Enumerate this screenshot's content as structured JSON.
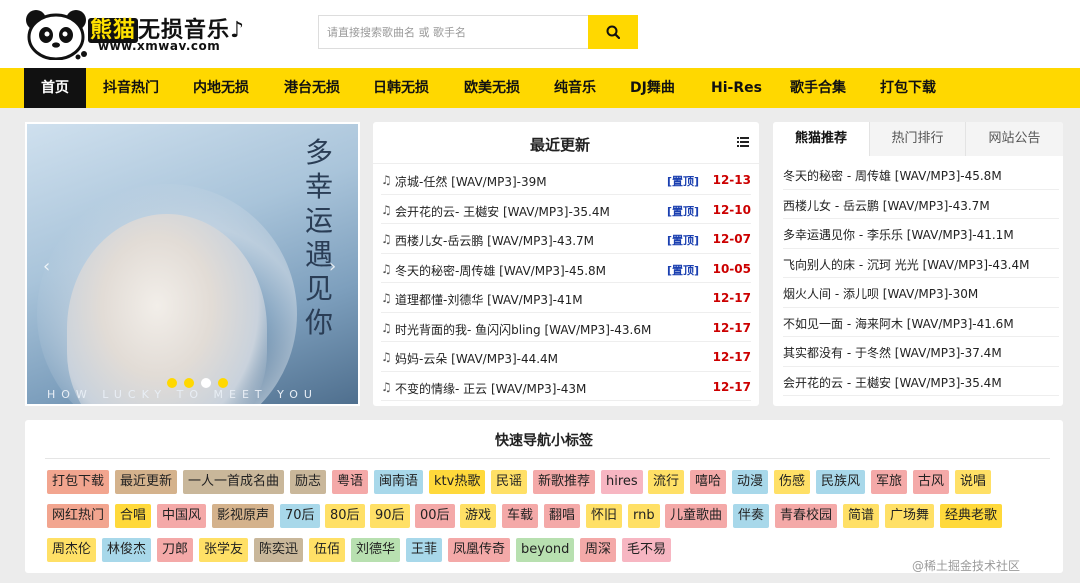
{
  "header": {
    "logo_title_highlight": "熊猫",
    "logo_title_rest": "无损音乐",
    "logo_url": "www.xmwav.com",
    "search_placeholder": "请直接搜索歌曲名 或 歌手名"
  },
  "nav": [
    "首页",
    "抖音热门",
    "内地无损",
    "港台无损",
    "日韩无损",
    "欧美无损",
    "纯音乐",
    "DJ舞曲",
    "Hi-Res",
    "歌手合集",
    "打包下载"
  ],
  "slider": {
    "title_chars": [
      "多",
      "幸",
      "运",
      "遇",
      "见",
      "你"
    ],
    "caption": "HOW LUCKY TO MEET YOU",
    "prev": "‹",
    "next": "›"
  },
  "latest": {
    "title": "最近更新",
    "note": "♫",
    "items": [
      {
        "name": "凉城-任然  [WAV/MP3]-39M",
        "pin": "[置顶]",
        "date": "12-13"
      },
      {
        "name": "会开花的云- 王樾安 [WAV/MP3]-35.4M",
        "pin": "[置顶]",
        "date": "12-10"
      },
      {
        "name": "西楼儿女-岳云鹏  [WAV/MP3]-43.7M",
        "pin": "[置顶]",
        "date": "12-07"
      },
      {
        "name": "冬天的秘密-周传雄  [WAV/MP3]-45.8M",
        "pin": "[置顶]",
        "date": "10-05"
      },
      {
        "name": "道理都懂-刘德华  [WAV/MP3]-41M",
        "pin": "",
        "date": "12-17"
      },
      {
        "name": "时光背面的我- 鱼闪闪bling [WAV/MP3]-43.6M",
        "pin": "",
        "date": "12-17"
      },
      {
        "name": "妈妈-云朵  [WAV/MP3]-44.4M",
        "pin": "",
        "date": "12-17"
      },
      {
        "name": "不变的情缘- 正云 [WAV/MP3]-43M",
        "pin": "",
        "date": "12-17"
      }
    ]
  },
  "tabs": {
    "labels": [
      "熊猫推荐",
      "热门排行",
      "网站公告"
    ],
    "items": [
      "冬天的秘密 - 周传雄  [WAV/MP3]-45.8M",
      "西楼儿女 - 岳云鹏  [WAV/MP3]-43.7M",
      "多幸运遇见你 -  李乐乐 [WAV/MP3]-41.1M",
      "飞向别人的床 - 沉珂 光光 [WAV/MP3]-43.4M",
      "烟火人间 - 添儿呗  [WAV/MP3]-30M",
      "不如见一面 - 海来阿木  [WAV/MP3]-41.6M",
      "其实都没有 - 于冬然  [WAV/MP3]-37.4M",
      "会开花的云 -  王樾安 [WAV/MP3]-35.4M"
    ]
  },
  "quicktags": {
    "title": "快速导航小标签",
    "rows": [
      [
        {
          "label": "打包下载",
          "color": "#f2a58f"
        },
        {
          "label": "最近更新",
          "color": "#d4b28c"
        },
        {
          "label": "一人一首成名曲",
          "color": "#c9b79a"
        },
        {
          "label": "励志",
          "color": "#c9b79a"
        },
        {
          "label": "粤语",
          "color": "#f4a9a8"
        },
        {
          "label": "闽南语",
          "color": "#a8d8ea"
        },
        {
          "label": "ktv热歌",
          "color": "#ffd93b"
        },
        {
          "label": "民谣",
          "color": "#ffe066"
        },
        {
          "label": "新歌推荐",
          "color": "#f4a9a8"
        },
        {
          "label": "hires",
          "color": "#f7b6c2"
        },
        {
          "label": "流行",
          "color": "#ffe066"
        },
        {
          "label": "嘻哈",
          "color": "#f4a9a8"
        },
        {
          "label": "动漫",
          "color": "#a8d8ea"
        },
        {
          "label": "伤感",
          "color": "#ffe066"
        },
        {
          "label": "民族风",
          "color": "#a8d8ea"
        },
        {
          "label": "军旅",
          "color": "#f4a9a8"
        },
        {
          "label": "古风",
          "color": "#f4a9a8"
        },
        {
          "label": "说唱",
          "color": "#ffe066"
        }
      ],
      [
        {
          "label": "网红热门",
          "color": "#f2a58f"
        },
        {
          "label": "合唱",
          "color": "#ffd93b"
        },
        {
          "label": "中国风",
          "color": "#f4a9a8"
        },
        {
          "label": "影视原声",
          "color": "#d4b28c"
        },
        {
          "label": "70后",
          "color": "#a8d8ea"
        },
        {
          "label": "80后",
          "color": "#ffe066"
        },
        {
          "label": "90后",
          "color": "#ffe066"
        },
        {
          "label": "00后",
          "color": "#f4a9a8"
        },
        {
          "label": "游戏",
          "color": "#ffe066"
        },
        {
          "label": "车载",
          "color": "#f4a9a8"
        },
        {
          "label": "翻唱",
          "color": "#f4a9a8"
        },
        {
          "label": "怀旧",
          "color": "#ffe066"
        },
        {
          "label": "rnb",
          "color": "#ffe066"
        },
        {
          "label": "儿童歌曲",
          "color": "#f4a9a8"
        },
        {
          "label": "伴奏",
          "color": "#a8d8ea"
        },
        {
          "label": "青春校园",
          "color": "#f4a9a8"
        },
        {
          "label": "简谱",
          "color": "#ffe066"
        },
        {
          "label": "广场舞",
          "color": "#ffe066"
        },
        {
          "label": "经典老歌",
          "color": "#ffd93b"
        }
      ],
      [
        {
          "label": "周杰伦",
          "color": "#ffe066"
        },
        {
          "label": "林俊杰",
          "color": "#a8d8ea"
        },
        {
          "label": "刀郎",
          "color": "#f4a9a8"
        },
        {
          "label": "张学友",
          "color": "#ffe066"
        },
        {
          "label": "陈奕迅",
          "color": "#c9b79a"
        },
        {
          "label": "伍佰",
          "color": "#ffe066"
        },
        {
          "label": "刘德华",
          "color": "#b8e0b0"
        },
        {
          "label": "王菲",
          "color": "#a8d8ea"
        },
        {
          "label": "凤凰传奇",
          "color": "#f4a9a8"
        },
        {
          "label": "beyond",
          "color": "#b8e0b0"
        },
        {
          "label": "周深",
          "color": "#f4a9a8"
        },
        {
          "label": "毛不易",
          "color": "#f7b6c2"
        }
      ]
    ]
  },
  "watermark": "@稀土掘金技术社区",
  "colors": {
    "accent": "#ffd800",
    "pin": "#1a3fb0",
    "date": "#cc0000"
  }
}
